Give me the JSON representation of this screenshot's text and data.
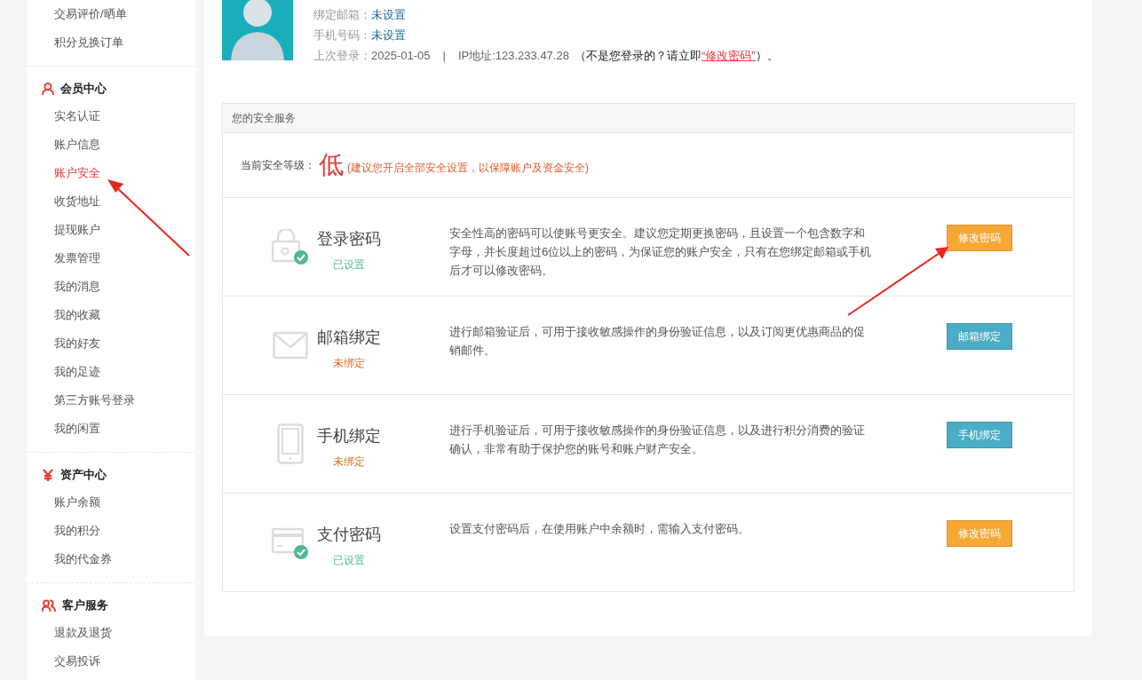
{
  "sidebar": {
    "groups": [
      {
        "items": [
          {
            "label": "交易评价/晒单",
            "selected": false
          },
          {
            "label": "积分兑换订单",
            "selected": false
          }
        ]
      },
      {
        "kind": "person",
        "title": "会员中心",
        "items": [
          {
            "label": "实名认证",
            "selected": false
          },
          {
            "label": "账户信息",
            "selected": false
          },
          {
            "label": "账户安全",
            "selected": true
          },
          {
            "label": "收货地址",
            "selected": false
          },
          {
            "label": "提现账户",
            "selected": false
          },
          {
            "label": "发票管理",
            "selected": false
          },
          {
            "label": "我的消息",
            "selected": false
          },
          {
            "label": "我的收藏",
            "selected": false
          },
          {
            "label": "我的好友",
            "selected": false
          },
          {
            "label": "我的足迹",
            "selected": false
          },
          {
            "label": "第三方账号登录",
            "selected": false
          },
          {
            "label": "我的闲置",
            "selected": false
          }
        ]
      },
      {
        "kind": "yen",
        "title": "资产中心",
        "items": [
          {
            "label": "账户余额",
            "selected": false
          },
          {
            "label": "我的积分",
            "selected": false
          },
          {
            "label": "我的代金券",
            "selected": false
          }
        ]
      },
      {
        "kind": "people",
        "title": "客户服务",
        "items": [
          {
            "label": "退款及退货",
            "selected": false
          },
          {
            "label": "交易投诉",
            "selected": false
          }
        ]
      }
    ]
  },
  "profile": {
    "fields": [
      {
        "label": "绑定邮箱：",
        "value": "未设置"
      },
      {
        "label": "手机号码：",
        "value": "未设置"
      }
    ],
    "last_login": {
      "label": "上次登录：",
      "date": "2025-01-05",
      "separator": "|",
      "ip": "IP地址:123.233.47.28",
      "notice": "（不是您登录的？请立即",
      "link": "“修改密码”",
      "notice_end": "）。"
    }
  },
  "security": {
    "title": "您的安全服务",
    "level_label": "当前安全等级：",
    "level": "低",
    "level_hint": "(建议您开启全部安全设置，以保障账户及资金安全)",
    "rows": [
      {
        "kind": "lock",
        "title": "登录密码",
        "set": true,
        "status": "已设置",
        "description": "安全性高的密码可以使账号更安全。建议您定期更换密码，且设置一个包含数字和字母，并长度超过6位以上的密码，为保证您的账户安全，只有在您绑定邮箱或手机后才可以修改密码。",
        "button": {
          "label": "修改密码",
          "color": "#f7a834"
        }
      },
      {
        "kind": "mail",
        "title": "邮箱绑定",
        "set": false,
        "status": "未绑定",
        "description": "进行邮箱验证后，可用于接收敏感操作的身份验证信息，以及订阅更优惠商品的促销邮件。",
        "button": {
          "label": "邮箱绑定",
          "color": "#4bacc6"
        }
      },
      {
        "kind": "phone",
        "title": "手机绑定",
        "set": false,
        "status": "未绑定",
        "description": "进行手机验证后，可用于接收敏感操作的身份验证信息，以及进行积分消费的验证确认，非常有助于保护您的账号和账户财产安全。",
        "button": {
          "label": "手机绑定",
          "color": "#4bacc6"
        }
      },
      {
        "kind": "card",
        "title": "支付密码",
        "set": true,
        "status": "已设置",
        "description": "设置支付密码后，在使用账户中余额时，需输入支付密码。",
        "button": {
          "label": "修改密码",
          "color": "#f7a834"
        }
      }
    ]
  }
}
